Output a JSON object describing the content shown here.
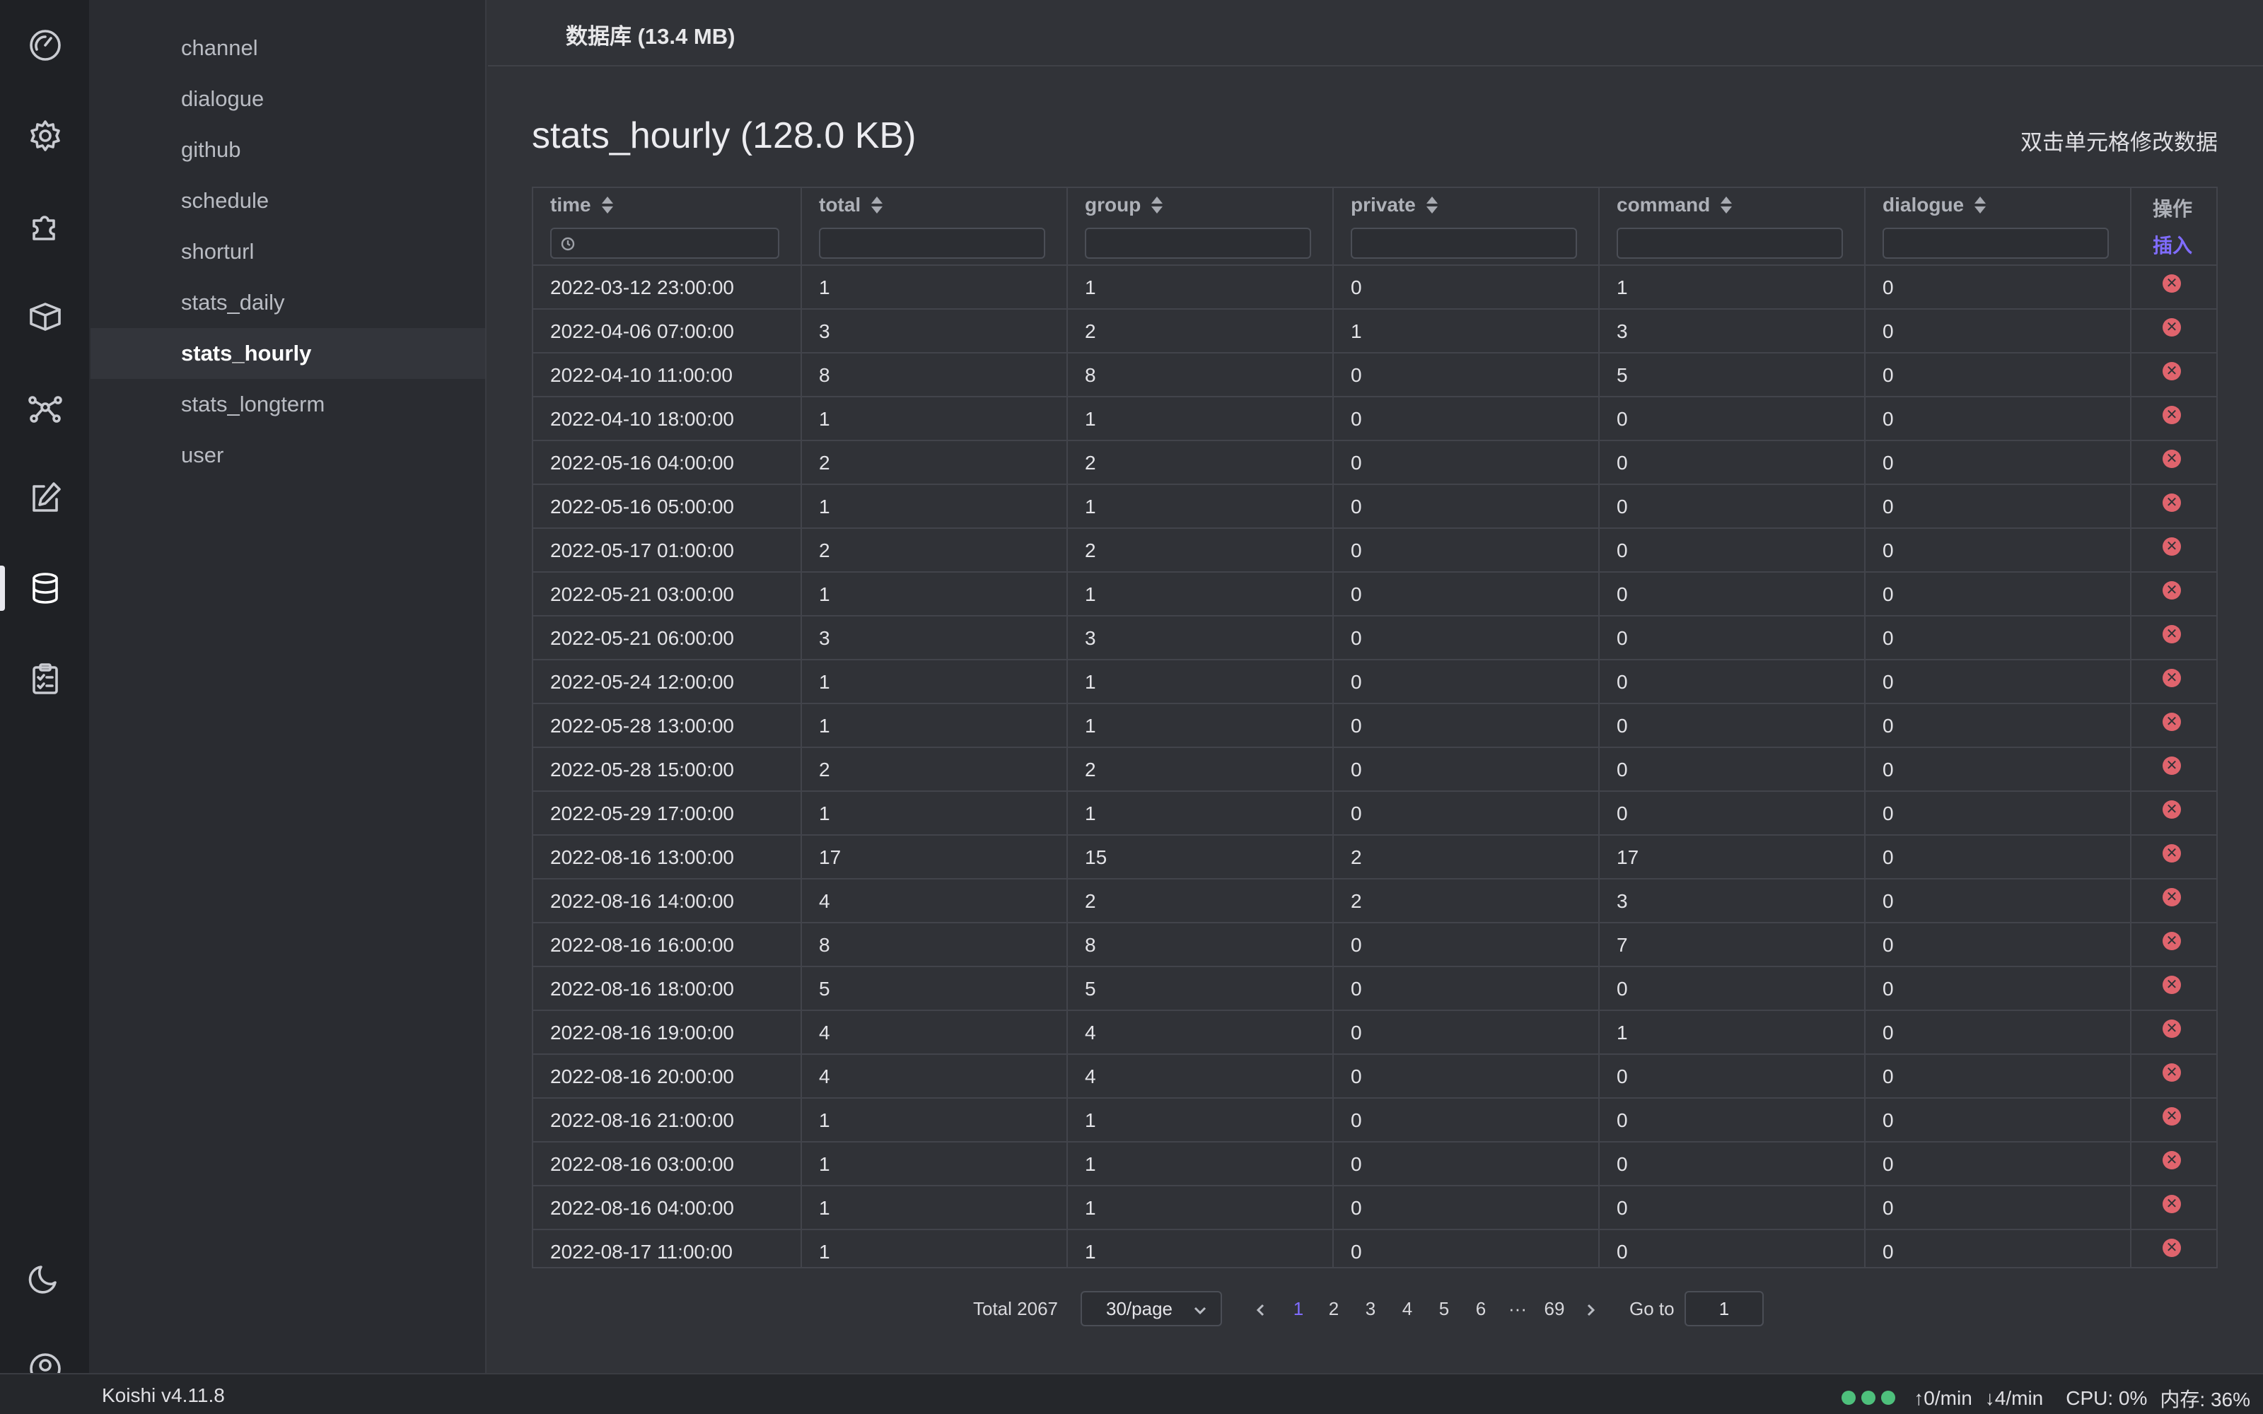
{
  "activity_bar": {
    "items": [
      {
        "icon": "dashboard-gauge-icon",
        "active": false
      },
      {
        "icon": "gear-icon",
        "active": false
      },
      {
        "icon": "puzzle-icon",
        "active": false
      },
      {
        "icon": "box-icon",
        "active": false
      },
      {
        "icon": "network-icon",
        "active": false
      },
      {
        "icon": "edit-icon",
        "active": false
      },
      {
        "icon": "database-icon",
        "active": true
      },
      {
        "icon": "clipboard-check-icon",
        "active": false
      }
    ],
    "bottom": [
      {
        "icon": "moon-icon"
      },
      {
        "icon": "user-icon"
      }
    ]
  },
  "tables": {
    "items": [
      {
        "label": "channel",
        "active": false
      },
      {
        "label": "dialogue",
        "active": false
      },
      {
        "label": "github",
        "active": false
      },
      {
        "label": "schedule",
        "active": false
      },
      {
        "label": "shorturl",
        "active": false
      },
      {
        "label": "stats_daily",
        "active": false
      },
      {
        "label": "stats_hourly",
        "active": true
      },
      {
        "label": "stats_longterm",
        "active": false
      },
      {
        "label": "user",
        "active": false
      }
    ]
  },
  "topbar": {
    "db_title": "数据库 (13.4 MB)"
  },
  "main": {
    "title": "stats_hourly (128.0 KB)",
    "hint": "双击单元格修改数据"
  },
  "table": {
    "columns": [
      "time",
      "total",
      "group",
      "private",
      "command",
      "dialogue"
    ],
    "ops_label": "操作",
    "insert_label": "插入",
    "rows": [
      [
        "2022-03-12 23:00:00",
        "1",
        "1",
        "0",
        "1",
        "0"
      ],
      [
        "2022-04-06 07:00:00",
        "3",
        "2",
        "1",
        "3",
        "0"
      ],
      [
        "2022-04-10 11:00:00",
        "8",
        "8",
        "0",
        "5",
        "0"
      ],
      [
        "2022-04-10 18:00:00",
        "1",
        "1",
        "0",
        "0",
        "0"
      ],
      [
        "2022-05-16 04:00:00",
        "2",
        "2",
        "0",
        "0",
        "0"
      ],
      [
        "2022-05-16 05:00:00",
        "1",
        "1",
        "0",
        "0",
        "0"
      ],
      [
        "2022-05-17 01:00:00",
        "2",
        "2",
        "0",
        "0",
        "0"
      ],
      [
        "2022-05-21 03:00:00",
        "1",
        "1",
        "0",
        "0",
        "0"
      ],
      [
        "2022-05-21 06:00:00",
        "3",
        "3",
        "0",
        "0",
        "0"
      ],
      [
        "2022-05-24 12:00:00",
        "1",
        "1",
        "0",
        "0",
        "0"
      ],
      [
        "2022-05-28 13:00:00",
        "1",
        "1",
        "0",
        "0",
        "0"
      ],
      [
        "2022-05-28 15:00:00",
        "2",
        "2",
        "0",
        "0",
        "0"
      ],
      [
        "2022-05-29 17:00:00",
        "1",
        "1",
        "0",
        "0",
        "0"
      ],
      [
        "2022-08-16 13:00:00",
        "17",
        "15",
        "2",
        "17",
        "0"
      ],
      [
        "2022-08-16 14:00:00",
        "4",
        "2",
        "2",
        "3",
        "0"
      ],
      [
        "2022-08-16 16:00:00",
        "8",
        "8",
        "0",
        "7",
        "0"
      ],
      [
        "2022-08-16 18:00:00",
        "5",
        "5",
        "0",
        "0",
        "0"
      ],
      [
        "2022-08-16 19:00:00",
        "4",
        "4",
        "0",
        "1",
        "0"
      ],
      [
        "2022-08-16 20:00:00",
        "4",
        "4",
        "0",
        "0",
        "0"
      ],
      [
        "2022-08-16 21:00:00",
        "1",
        "1",
        "0",
        "0",
        "0"
      ],
      [
        "2022-08-16 03:00:00",
        "1",
        "1",
        "0",
        "0",
        "0"
      ],
      [
        "2022-08-16 04:00:00",
        "1",
        "1",
        "0",
        "0",
        "0"
      ],
      [
        "2022-08-17 11:00:00",
        "1",
        "1",
        "0",
        "0",
        "0"
      ]
    ]
  },
  "pagination": {
    "total": "Total 2067",
    "page_size": "30/page",
    "pages": [
      "1",
      "2",
      "3",
      "4",
      "5",
      "6",
      "···",
      "69"
    ],
    "current": "1",
    "goto_label": "Go to",
    "goto_value": "1"
  },
  "statusbar": {
    "version": "Koishi v4.11.8",
    "upload": "0/min",
    "download": "4/min",
    "cpu": "CPU: 0%",
    "memory": "内存: 36%"
  },
  "colors": {
    "accent": "#7f6cff",
    "danger": "#e0646d",
    "status_ok": "#4ec07c"
  }
}
